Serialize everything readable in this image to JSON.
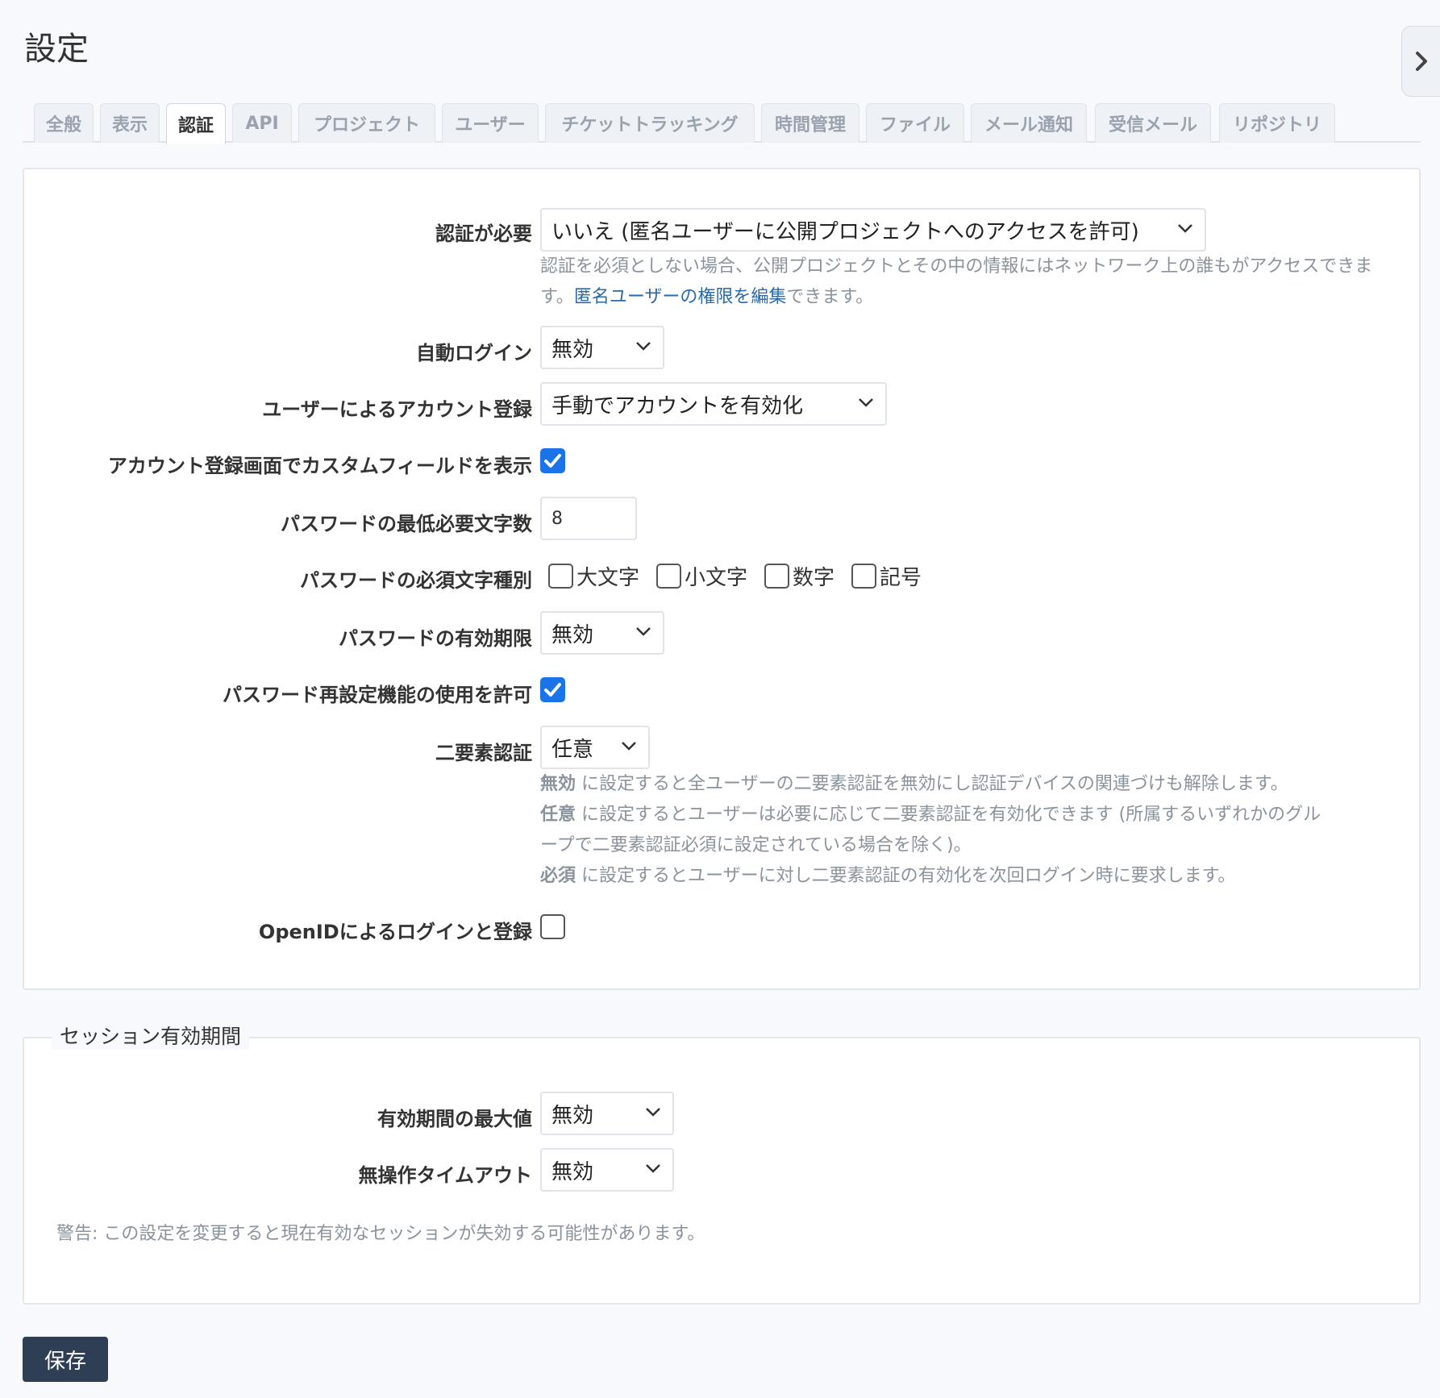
{
  "page": {
    "title": "設定"
  },
  "tabs": [
    {
      "label": "全般"
    },
    {
      "label": "表示"
    },
    {
      "label": "認証",
      "active": true
    },
    {
      "label": "API"
    },
    {
      "label": "プロジェクト"
    },
    {
      "label": "ユーザー"
    },
    {
      "label": "チケットトラッキング"
    },
    {
      "label": "時間管理"
    },
    {
      "label": "ファイル"
    },
    {
      "label": "メール通知"
    },
    {
      "label": "受信メール"
    },
    {
      "label": "リポジトリ"
    }
  ],
  "auth": {
    "login_required": {
      "label": "認証が必要",
      "value": "いいえ (匿名ユーザーに公開プロジェクトへのアクセスを許可)",
      "hint_before": "認証を必須としない場合、公開プロジェクトとその中の情報にはネットワーク上の誰もがアクセスできます。",
      "hint_link": "匿名ユーザーの権限を編集",
      "hint_after": "できます。"
    },
    "autologin": {
      "label": "自動ログイン",
      "value": "無効"
    },
    "self_registration": {
      "label": "ユーザーによるアカウント登録",
      "value": "手動でアカウントを有効化"
    },
    "show_custom_fields": {
      "label": "アカウント登録画面でカスタムフィールドを表示",
      "checked": true
    },
    "password_min_length": {
      "label": "パスワードの最低必要文字数",
      "value": "8"
    },
    "password_required_chars": {
      "label": "パスワードの必須文字種別",
      "options": [
        "大文字",
        "小文字",
        "数字",
        "記号"
      ]
    },
    "password_max_age": {
      "label": "パスワードの有効期限",
      "value": "無効"
    },
    "lost_password": {
      "label": "パスワード再設定機能の使用を許可",
      "checked": true
    },
    "twofa": {
      "label": "二要素認証",
      "value": "任意",
      "hint_disabled_term": "無効",
      "hint_disabled": "に設定すると全ユーザーの二要素認証を無効にし認証デバイスの関連づけも解除します。",
      "hint_optional_term": "任意",
      "hint_optional_1": "に設定するとユーザーは必要に応じて二要素認証を有効化できます (所属するいずれかのグル",
      "hint_optional_2": "ープで二要素認証必須に設定されている場合を除く)。",
      "hint_required_term": "必須",
      "hint_required": "に設定するとユーザーに対し二要素認証の有効化を次回ログイン時に要求します。"
    },
    "openid": {
      "label": "OpenIDによるログインと登録",
      "checked": false
    }
  },
  "session": {
    "legend": "セッション有効期間",
    "lifetime": {
      "label": "有効期間の最大値",
      "value": "無効"
    },
    "timeout": {
      "label": "無操作タイムアウト",
      "value": "無効"
    },
    "warning": "警告: この設定を変更すると現在有効なセッションが失効する可能性があります。"
  },
  "save_label": "保存",
  "colors": {
    "accent": "#1a73e8",
    "save_bg": "#2e3f55",
    "link": "#2b6aa8"
  }
}
